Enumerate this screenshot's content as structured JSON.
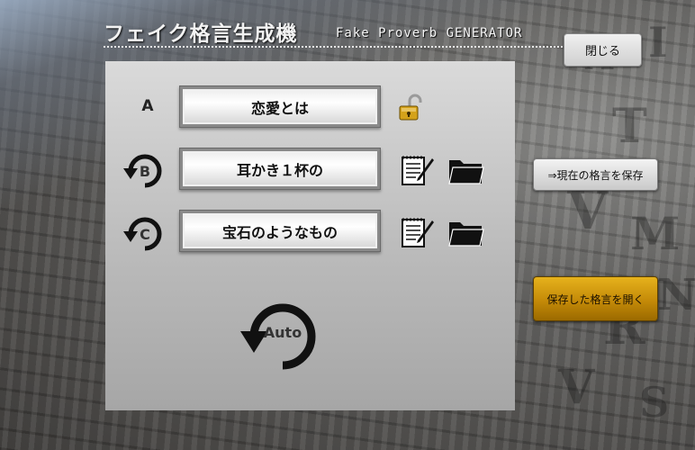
{
  "header": {
    "title": "フェイク格言生成機",
    "subtitle": "Fake Proverb GENERATOR",
    "close_label": "閉じる"
  },
  "rows": [
    {
      "label": "A",
      "word": "恋愛とは",
      "icon": "unlocked-padlock-icon"
    },
    {
      "label": "B",
      "word": "耳かき１杯の",
      "icon": "refresh-icon"
    },
    {
      "label": "C",
      "word": "宝石のようなもの",
      "icon": "refresh-icon"
    }
  ],
  "auto_label": "Auto",
  "actions": {
    "save_current": "⇒現在の格言を保存",
    "open_saved": "保存した格言を開く"
  },
  "background_letters": [
    "A",
    "I",
    "T",
    "V",
    "M",
    "E",
    "R",
    "N",
    "V",
    "S"
  ],
  "colors": {
    "accent_gold": "#c48a08",
    "panel_gray": "#c4c4c4",
    "title_text": "#f2f2f2"
  }
}
